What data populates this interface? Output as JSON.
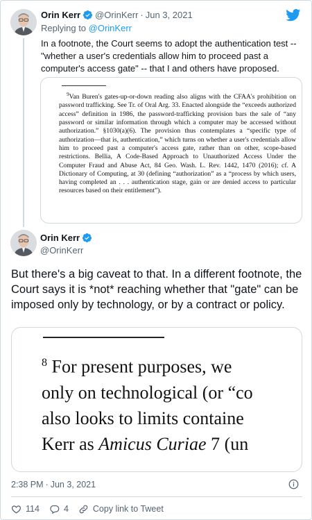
{
  "tweet1": {
    "author_name": "Orin Kerr",
    "handle": "@OrinKerr",
    "separator": "·",
    "date": "Jun 3, 2021",
    "replying_prefix": "Replying to ",
    "replying_handle": "@OrinKerr",
    "text": "In a footnote, the Court seems to adopt the authentication test -- \"whether a user's credentials allow him to proceed past a computer's access gate\" -- that I and others have proposed.",
    "image": {
      "footnote_number": "9",
      "footnote_text": "Van Buren's gates-up-or-down reading also aligns with the CFAA's prohibition on password trafficking. See Tr. of Oral Arg. 33. Enacted alongside the “exceeds authorized access” definition in 1986, the password-trafficking provision bars the sale of “any password or similar information through which a computer may be accessed without authorization.” §1030(a)(6). The provision thus contemplates a “specific type of authorization—that is, authentication,” which turns on whether a user's credentials allow him to proceed past a computer's access gate, rather than on other, scope-based restrictions. Bellia, A Code-Based Approach to Unauthorized Access Under the Computer Fraud and Abuse Act, 84 Geo. Wash. L. Rev. 1442, 1470 (2016); cf. A Dictionary of Computing, at 30 (defining “authorization” as a “process by which users, having completed an . . . authentication stage, gain or are denied access to particular resources based on their entitlement”)."
    }
  },
  "tweet2": {
    "author_name": "Orin Kerr",
    "handle": "@OrinKerr",
    "text": "But there's a big caveat to that.  In a different footnote, the Court says it is *not* reaching whether that \"gate\" can be imposed only by technology, or by a contract or policy.",
    "image": {
      "footnote_number": "8",
      "line1": "For present purposes, we",
      "line2": "only on technological (or “co",
      "line3": "also looks to limits containe",
      "line4_pre": "Kerr as ",
      "line4_italic": "Amicus Curiae",
      "line4_post": " 7 (un"
    },
    "time": "2:38 PM",
    "separator": "·",
    "date": "Jun 3, 2021"
  },
  "actions": {
    "likes": "114",
    "replies": "4",
    "copy_link": "Copy link to Tweet"
  },
  "colors": {
    "accent": "#1d9bf0",
    "muted": "#536471",
    "border": "#cfd9de",
    "like": "#f91880"
  }
}
